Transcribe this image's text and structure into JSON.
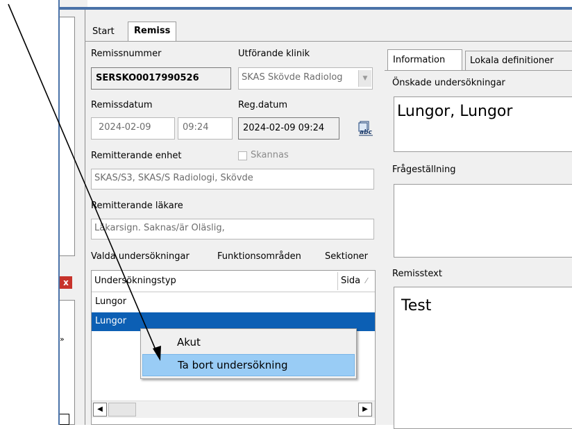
{
  "tabs": {
    "start": "Start",
    "remiss": "Remiss"
  },
  "remissnummer": {
    "label": "Remissnummer",
    "value": "SERSKO0017990526"
  },
  "utforande": {
    "label": "Utförande klinik",
    "value": "SKAS Skövde Radiolog"
  },
  "remissdatum": {
    "label": "Remissdatum",
    "date": "2024-02-09",
    "time": "09:24"
  },
  "regdatum": {
    "label": "Reg.datum",
    "value": "2024-02-09 09:24"
  },
  "remitterande_enhet": {
    "label": "Remitterande enhet",
    "value": "SKAS/S3, SKAS/S Radiologi, Skövde"
  },
  "skannas": {
    "label": "Skannas",
    "checked": false
  },
  "remitterande_lakare": {
    "label": "Remitterande läkare",
    "value": "Läkarsign. Saknas/är Oläslig,"
  },
  "lower_tabs": [
    "Valda undersökningar",
    "Funktionsområden",
    "Sektioner"
  ],
  "grid": {
    "columns": [
      "Undersökningstyp",
      "Sida"
    ],
    "rows": [
      "Lungor",
      "Lungor"
    ],
    "selected_index": 1
  },
  "context_menu": {
    "items": [
      "Akut",
      "Ta bort undersökning"
    ],
    "highlighted_index": 1
  },
  "right_tabs": {
    "information": "Information",
    "lokala": "Lokala definitioner"
  },
  "onskade": {
    "label": "Önskade undersökningar",
    "value": "Lungor, Lungor"
  },
  "fragestallning": {
    "label": "Frågeställning",
    "value": ""
  },
  "remisstext": {
    "label": "Remisstext",
    "value": "Test"
  },
  "colors": {
    "selection": "#0c5fb4",
    "menu_highlight": "#99ccf5",
    "window_border": "#4a72a8",
    "close_red": "#c7332b"
  },
  "icons": {
    "spell": "spellcheck-icon",
    "close": "close-icon"
  }
}
